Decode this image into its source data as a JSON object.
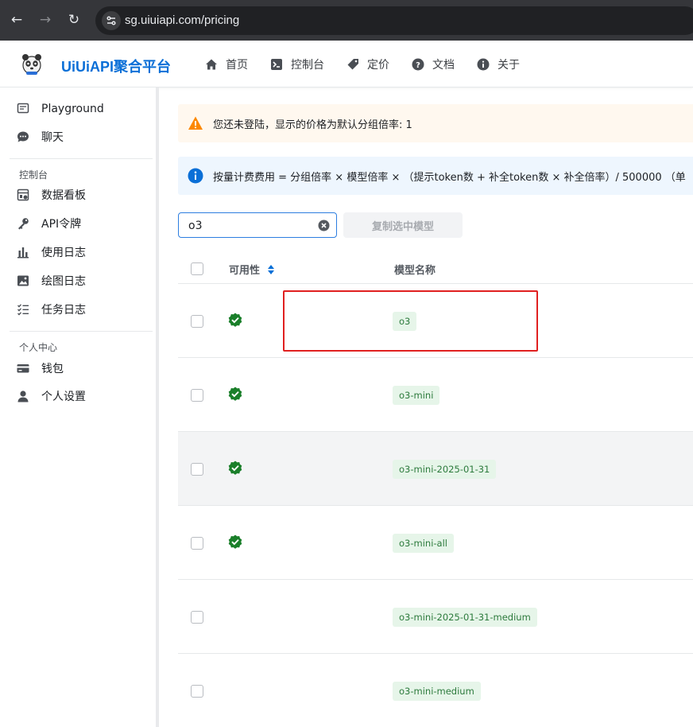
{
  "browser": {
    "url": "sg.uiuiapi.com/pricing"
  },
  "header": {
    "brand": "UiUiAPI聚合平台",
    "nav": [
      {
        "label": "首页",
        "icon": "home-icon"
      },
      {
        "label": "控制台",
        "icon": "terminal-icon"
      },
      {
        "label": "定价",
        "icon": "price-tag-icon"
      },
      {
        "label": "文档",
        "icon": "help-circle-icon"
      },
      {
        "label": "关于",
        "icon": "info-circle-icon"
      }
    ]
  },
  "sidebar": {
    "top_items": [
      {
        "label": "Playground",
        "icon": "playground-icon"
      },
      {
        "label": "聊天",
        "icon": "chat-icon"
      }
    ],
    "console_group": "控制台",
    "console_items": [
      {
        "label": "数据看板",
        "icon": "dashboard-icon"
      },
      {
        "label": "API令牌",
        "icon": "key-icon"
      },
      {
        "label": "使用日志",
        "icon": "bar-chart-icon"
      },
      {
        "label": "绘图日志",
        "icon": "image-icon"
      },
      {
        "label": "任务日志",
        "icon": "task-list-icon"
      }
    ],
    "personal_group": "个人中心",
    "personal_items": [
      {
        "label": "钱包",
        "icon": "wallet-icon"
      },
      {
        "label": "个人设置",
        "icon": "user-icon"
      }
    ]
  },
  "notices": {
    "warning": "您还未登陆，显示的价格为默认分组倍率: 1",
    "info": "按量计费费用 = 分组倍率 × 模型倍率 × （提示token数 + 补全token数 × 补全倍率）/ 500000 （单"
  },
  "search": {
    "value": "o3"
  },
  "copy_button": "复制选中模型",
  "table": {
    "headers": {
      "availability": "可用性",
      "model_name": "模型名称"
    },
    "rows": [
      {
        "model": "o3",
        "available": true
      },
      {
        "model": "o3-mini",
        "available": true
      },
      {
        "model": "o3-mini-2025-01-31",
        "available": true
      },
      {
        "model": "o3-mini-all",
        "available": true
      },
      {
        "model": "o3-mini-2025-01-31-medium",
        "available": false
      },
      {
        "model": "o3-mini-medium",
        "available": false
      }
    ]
  },
  "colors": {
    "brand": "#0a6fd7",
    "available": "#1a7f2a",
    "highlight": "#e02020",
    "tag_bg": "#e6f5e9",
    "tag_text": "#2c7a3c"
  }
}
